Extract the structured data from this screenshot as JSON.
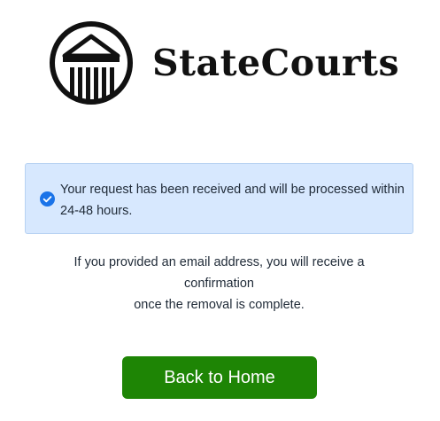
{
  "brand": {
    "name": "StateCourts",
    "logo_icon": "courthouse-pillars-icon"
  },
  "alert": {
    "icon": "check-circle-icon",
    "message": "Your request has been received and will be processed within 24-48 hours.",
    "color": "#d7e8fe",
    "icon_color": "#1a73e8"
  },
  "info": {
    "line1": "If you provided an email address, you will receive a",
    "line2": "confirmation",
    "line3": "once the removal is complete."
  },
  "actions": {
    "back_home_label": "Back to Home",
    "button_color": "#1e8505"
  }
}
